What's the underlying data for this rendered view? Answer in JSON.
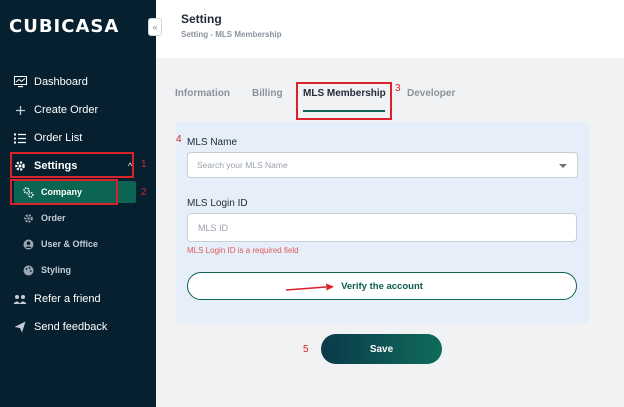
{
  "brand": {
    "logo_text": "CUBICASA"
  },
  "sidebar": {
    "collapse_icon": "«",
    "items": [
      {
        "label": "Dashboard",
        "icon": "monitor-icon"
      },
      {
        "label": "Create Order",
        "icon": "plus-icon"
      },
      {
        "label": "Order List",
        "icon": "list-icon"
      },
      {
        "label": "Settings",
        "icon": "gear-icon",
        "expanded_chevron": "^"
      },
      {
        "label": "Refer a friend",
        "icon": "people-icon"
      },
      {
        "label": "Send feedback",
        "icon": "send-icon"
      }
    ],
    "settings_children": [
      {
        "label": "Company",
        "icon": "cogs-icon",
        "active": true
      },
      {
        "label": "Order",
        "icon": "gear-icon"
      },
      {
        "label": "User & Office",
        "icon": "user-icon"
      },
      {
        "label": "Styling",
        "icon": "palette-icon"
      }
    ]
  },
  "header": {
    "title": "Setting",
    "breadcrumb": "Setting  -  MLS Membership"
  },
  "tabs": [
    {
      "label": "Information",
      "active": false
    },
    {
      "label": "Billing",
      "active": false
    },
    {
      "label": "MLS Membership",
      "active": true
    },
    {
      "label": "Developer",
      "active": false
    }
  ],
  "form": {
    "mls_name_label": "MLS Name",
    "mls_name_placeholder": "Search your MLS Name",
    "login_label": "MLS Login ID",
    "login_placeholder": "MLS ID",
    "login_value": "",
    "error": "MLS Login ID is a required field",
    "verify_label": "Verify the account",
    "save_label": "Save"
  },
  "annotations": [
    "1",
    "2",
    "3",
    "4",
    "5"
  ],
  "colors": {
    "sidebar_bg": "#06202f",
    "accent_green": "#0c6552",
    "annotation_red": "#d9232b",
    "error_red": "#e05a5a",
    "card_bg": "#e5eef9"
  }
}
